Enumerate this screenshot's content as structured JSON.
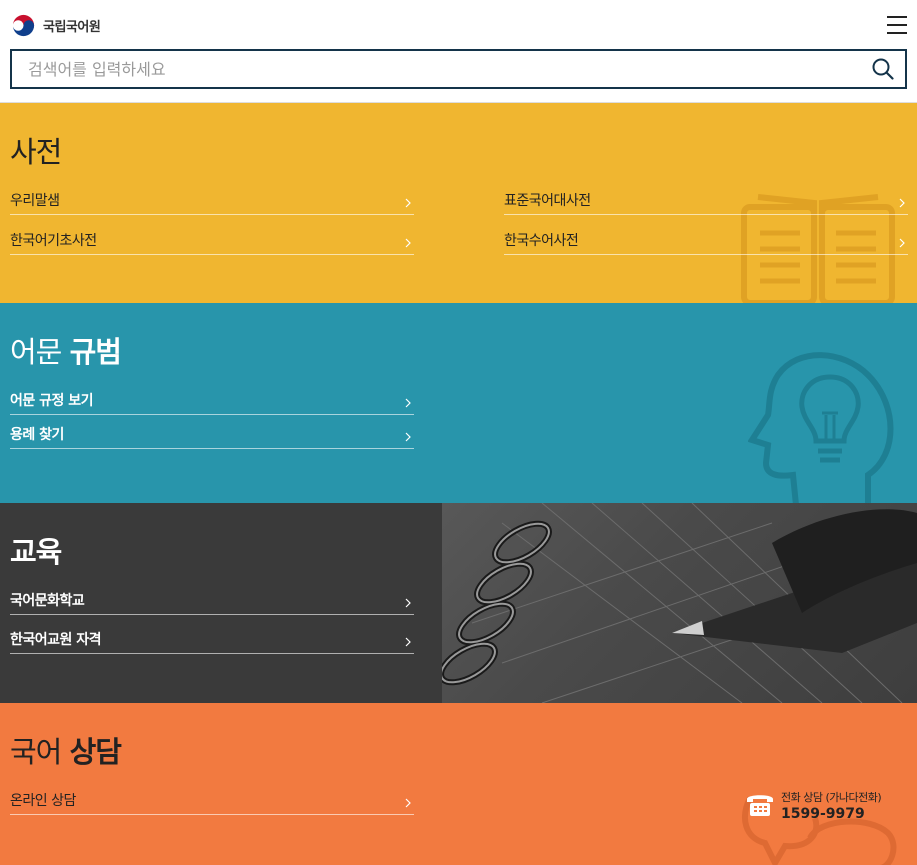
{
  "header": {
    "logo_text": "국립국어원",
    "search_placeholder": "검색어를 입력하세요"
  },
  "dictionary": {
    "title": "사전",
    "links_left": [
      "우리말샘",
      "한국어기초사전"
    ],
    "links_right": [
      "표준국어대사전",
      "한국수어사전"
    ]
  },
  "norms": {
    "title_light": "어문 ",
    "title_bold": "규범",
    "links": [
      "어문 규정 보기",
      "용례 찾기"
    ]
  },
  "education": {
    "title": "교육",
    "links": [
      "국어문화학교",
      "한국어교원 자격"
    ]
  },
  "consult": {
    "title_light": "국어 ",
    "title_bold": "상담",
    "links": [
      "온라인 상담"
    ],
    "phone_label": "전화 상담 (가나다전화)",
    "phone_number": "1599-9979"
  },
  "colors": {
    "dictionary_bg": "#f0b630",
    "norms_bg": "#2895ab",
    "education_bg": "#3a3a3a",
    "consult_bg": "#f27a40",
    "search_border": "#14344a"
  }
}
